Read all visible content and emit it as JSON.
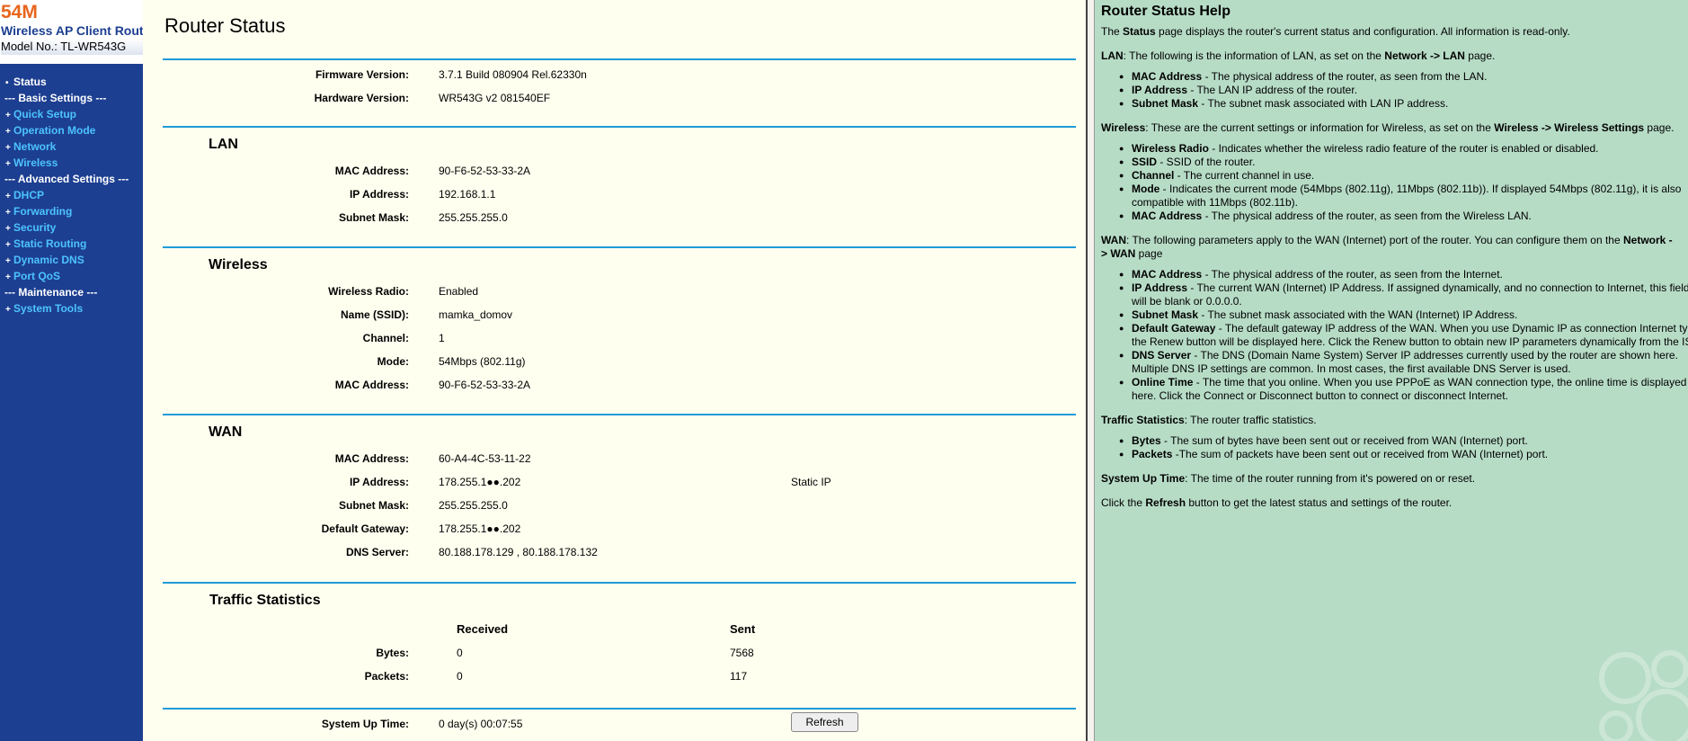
{
  "brand": {
    "speed": "54M",
    "product": "Wireless AP Client Router",
    "model": "Model No.: TL-WR543G"
  },
  "menu": [
    {
      "type": "item",
      "label": "Status",
      "active": true
    },
    {
      "type": "section",
      "label": "--- Basic Settings ---"
    },
    {
      "type": "item",
      "label": "Quick Setup"
    },
    {
      "type": "item",
      "label": "Operation Mode"
    },
    {
      "type": "item",
      "label": "Network"
    },
    {
      "type": "item",
      "label": "Wireless"
    },
    {
      "type": "section",
      "label": "--- Advanced Settings ---"
    },
    {
      "type": "item",
      "label": "DHCP"
    },
    {
      "type": "item",
      "label": "Forwarding"
    },
    {
      "type": "item",
      "label": "Security"
    },
    {
      "type": "item",
      "label": "Static Routing"
    },
    {
      "type": "item",
      "label": "Dynamic DNS"
    },
    {
      "type": "item",
      "label": "Port QoS"
    },
    {
      "type": "section",
      "label": "--- Maintenance ---"
    },
    {
      "type": "item",
      "label": "System Tools"
    }
  ],
  "main": {
    "title": "Router Status",
    "firmware": {
      "label": "Firmware Version:",
      "value": "3.7.1 Build 080904 Rel.62330n"
    },
    "hardware": {
      "label": "Hardware Version:",
      "value": "WR543G v2 081540EF"
    },
    "lan": {
      "title": "LAN",
      "mac": {
        "label": "MAC Address:",
        "value": "90-F6-52-53-33-2A"
      },
      "ip": {
        "label": "IP Address:",
        "value": "192.168.1.1"
      },
      "mask": {
        "label": "Subnet Mask:",
        "value": "255.255.255.0"
      }
    },
    "wireless": {
      "title": "Wireless",
      "radio": {
        "label": "Wireless Radio:",
        "value": "Enabled"
      },
      "ssid": {
        "label": "Name (SSID):",
        "value": "mamka_domov"
      },
      "channel": {
        "label": "Channel:",
        "value": "1"
      },
      "mode": {
        "label": "Mode:",
        "value": "54Mbps (802.11g)"
      },
      "mac": {
        "label": "MAC Address:",
        "value": "90-F6-52-53-33-2A"
      }
    },
    "wan": {
      "title": "WAN",
      "mac": {
        "label": "MAC Address:",
        "value": "60-A4-4C-53-11-22"
      },
      "ip": {
        "label": "IP Address:",
        "value": "178.255.1●●.202",
        "type": "Static IP"
      },
      "mask": {
        "label": "Subnet Mask:",
        "value": "255.255.255.0"
      },
      "gateway": {
        "label": "Default Gateway:",
        "value": "178.255.1●●.202"
      },
      "dns": {
        "label": "DNS Server:",
        "value": "80.188.178.129 , 80.188.178.132"
      }
    },
    "traffic": {
      "title": "Traffic Statistics",
      "col_received": "Received",
      "col_sent": "Sent",
      "bytes": {
        "label": "Bytes:",
        "received": "0",
        "sent": "7568"
      },
      "packets": {
        "label": "Packets:",
        "received": "0",
        "sent": "117"
      }
    },
    "uptime": {
      "label": "System Up Time:",
      "value": "0 day(s) 00:07:55"
    },
    "refresh_label": "Refresh"
  },
  "help": {
    "title": "Router Status Help",
    "intro": {
      "a": "The ",
      "b": "Status",
      "c": " page displays the router's current status and configuration. All information is read-only."
    },
    "lan_intro": {
      "a": "LAN",
      "b": ": The following is the information of LAN, as set on the ",
      "c": "Network -> LAN",
      "d": " page."
    },
    "lan_items": [
      {
        "term": "MAC Address",
        "desc": " - The physical address of the router, as seen from the LAN."
      },
      {
        "term": "IP Address",
        "desc": " - The LAN IP address of the router."
      },
      {
        "term": "Subnet Mask",
        "desc": " - The subnet mask associated with LAN IP address."
      }
    ],
    "wireless_intro": {
      "a": "Wireless",
      "b": ": These are the current settings or information for Wireless, as set on the ",
      "c": "Wireless -> Wireless Settings",
      "d": " page."
    },
    "wireless_items": [
      {
        "term": "Wireless Radio",
        "desc": " - Indicates whether the wireless radio feature of the router is enabled or disabled."
      },
      {
        "term": "SSID",
        "desc": " - SSID of the router."
      },
      {
        "term": "Channel",
        "desc": " - The current channel in use."
      },
      {
        "term": "Mode",
        "desc": " - Indicates the current mode (54Mbps (802.11g), 11Mbps (802.11b)). If displayed 54Mbps (802.11g), it is also compatible with 11Mbps (802.11b)."
      },
      {
        "term": "MAC Address",
        "desc": " - The physical address of the router, as seen from the Wireless LAN."
      }
    ],
    "wan_intro": {
      "a": "WAN",
      "b": ": The following parameters apply to the WAN (Internet) port of the router. You can configure them on the ",
      "c": "Network -> WAN",
      "d": " page"
    },
    "wan_items": [
      {
        "term": "MAC Address",
        "desc": " - The physical address of the router, as seen from the Internet."
      },
      {
        "term": "IP Address",
        "desc": " - The current WAN (Internet) IP Address. If assigned dynamically, and no connection to Internet, this field will be blank or 0.0.0.0."
      },
      {
        "term": "Subnet Mask",
        "desc": " - The subnet mask associated with the WAN (Internet) IP Address."
      },
      {
        "term": "Default Gateway",
        "desc": " - The default gateway IP address of the WAN. When you use Dynamic IP as connection Internet type, the Renew button will be displayed here. Click the Renew button to obtain new IP parameters dynamically from the ISP."
      },
      {
        "term": "DNS Server",
        "desc": " - The DNS (Domain Name System) Server IP addresses currently used by the router are shown here. Multiple DNS IP settings are common. In most cases, the first available DNS Server is used."
      },
      {
        "term": "Online Time",
        "desc": " - The time that you online. When you use PPPoE as WAN connection type, the online time is displayed here. Click the Connect or Disconnect button to connect or disconnect Internet."
      }
    ],
    "traffic_intro": {
      "a": "Traffic Statistics",
      "b": ": The router traffic statistics."
    },
    "traffic_items": [
      {
        "term": "Bytes",
        "desc": " - The sum of bytes have been sent out or received from WAN (Internet) port."
      },
      {
        "term": "Packets",
        "desc": " -The sum of packets have been sent out or received from WAN (Internet) port."
      }
    ],
    "uptime_intro": {
      "a": "System Up Time",
      "b": ": The time of the router running from it's powered on or reset."
    },
    "refresh_intro": {
      "a": "Click the ",
      "b": "Refresh",
      "c": " button to get the latest status and settings of the router."
    }
  }
}
